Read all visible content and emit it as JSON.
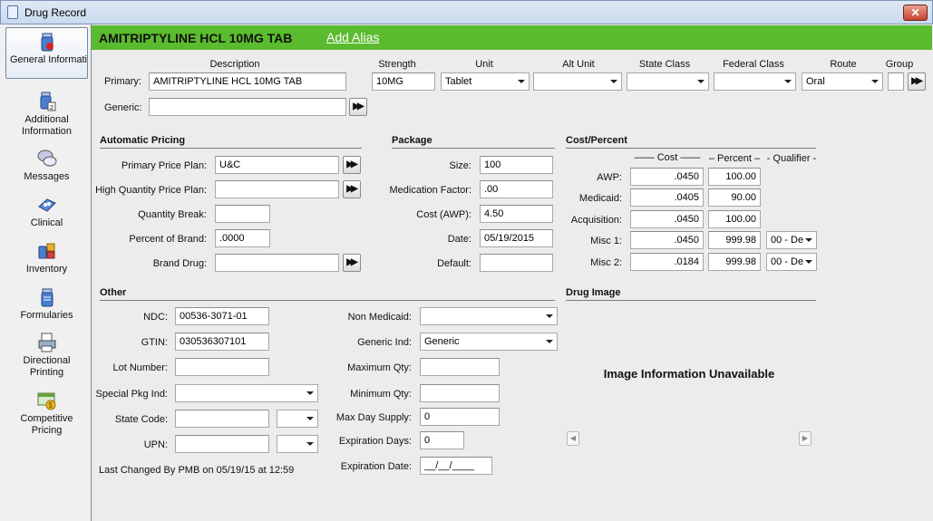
{
  "window": {
    "title": "Drug Record",
    "close": "✕"
  },
  "sidebar": [
    {
      "label": "General Information",
      "icon": "pill-bottle-icon"
    },
    {
      "label": "Additional Information",
      "icon": "bottle-2-icon"
    },
    {
      "label": "Messages",
      "icon": "speech-bubbles-icon"
    },
    {
      "label": "Clinical",
      "icon": "pills-tray-icon"
    },
    {
      "label": "Inventory",
      "icon": "bottles-boxes-icon"
    },
    {
      "label": "Formularies",
      "icon": "bottle-list-icon"
    },
    {
      "label": "Directional Printing",
      "icon": "printer-icon"
    },
    {
      "label": "Competitive Pricing",
      "icon": "price-card-icon"
    }
  ],
  "header": {
    "drug_name": "AMITRIPTYLINE HCL 10MG TAB",
    "add_alias": "Add Alias"
  },
  "columns": {
    "description": "Description",
    "strength": "Strength",
    "unit": "Unit",
    "alt_unit": "Alt Unit",
    "state_class": "State Class",
    "federal_class": "Federal Class",
    "route": "Route",
    "group": "Group"
  },
  "primary": {
    "label": "Primary:",
    "description": "AMITRIPTYLINE HCL 10MG TAB",
    "strength": "10MG",
    "unit": "Tablet",
    "alt_unit": "",
    "state_class": "",
    "federal_class": "",
    "route": "Oral",
    "group": ""
  },
  "generic": {
    "label": "Generic:",
    "value": ""
  },
  "auto_pricing": {
    "title": "Automatic Pricing",
    "primary_price_plan_label": "Primary Price Plan:",
    "primary_price_plan": "U&C",
    "high_qty_label": "High Quantity Price Plan:",
    "high_qty": "",
    "qty_break_label": "Quantity Break:",
    "qty_break": "",
    "pct_brand_label": "Percent of Brand:",
    "pct_brand": ".0000",
    "brand_drug_label": "Brand Drug:",
    "brand_drug": ""
  },
  "package": {
    "title": "Package",
    "size_label": "Size:",
    "size": "100",
    "med_factor_label": "Medication Factor:",
    "med_factor": ".00",
    "cost_awp_label": "Cost (AWP):",
    "cost_awp": "4.50",
    "date_label": "Date:",
    "date": "05/19/2015",
    "default_label": "Default:",
    "default": ""
  },
  "cost_percent": {
    "title": "Cost/Percent",
    "col_cost": "Cost",
    "col_percent": "Percent",
    "col_qualifier": "Qualifier",
    "rows": [
      {
        "label": "AWP:",
        "cost": ".0450",
        "percent": "100.00",
        "qualifier": null
      },
      {
        "label": "Medicaid:",
        "cost": ".0405",
        "percent": "90.00",
        "qualifier": null
      },
      {
        "label": "Acquisition:",
        "cost": ".0450",
        "percent": "100.00",
        "qualifier": null
      },
      {
        "label": "Misc 1:",
        "cost": ".0450",
        "percent": "999.98",
        "qualifier": "00 - De"
      },
      {
        "label": "Misc 2:",
        "cost": ".0184",
        "percent": "999.98",
        "qualifier": "00 - De"
      }
    ]
  },
  "other": {
    "title": "Other",
    "ndc_label": "NDC:",
    "ndc": "00536-3071-01",
    "gtin_label": "GTIN:",
    "gtin": "030536307101",
    "lot_label": "Lot Number:",
    "lot": "",
    "special_pkg_label": "Special Pkg Ind:",
    "special_pkg": "",
    "state_code_label": "State Code:",
    "state_code": "",
    "state_code_sel": "",
    "upn_label": "UPN:",
    "upn": "",
    "upn_sel": "",
    "last_changed": "Last Changed By PMB on 05/19/15 at 12:59",
    "non_medicaid_label": "Non Medicaid:",
    "non_medicaid": "",
    "generic_ind_label": "Generic Ind:",
    "generic_ind": "Generic",
    "max_qty_label": "Maximum Qty:",
    "max_qty": "",
    "min_qty_label": "Minimum Qty:",
    "min_qty": "",
    "max_day_label": "Max Day Supply:",
    "max_day": "0",
    "exp_days_label": "Expiration Days:",
    "exp_days": "0",
    "exp_date_label": "Expiration Date:",
    "exp_date": "__/__/____"
  },
  "drug_image": {
    "title": "Drug Image",
    "message": "Image Information Unavailable",
    "prev": "◀",
    "next": "▶"
  },
  "lookup_glyph": "▶▶"
}
